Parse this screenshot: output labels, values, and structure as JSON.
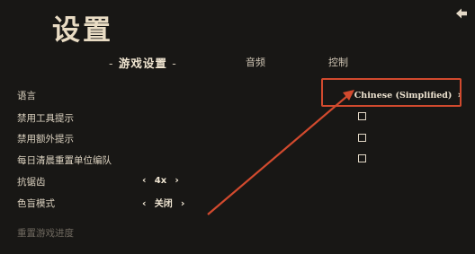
{
  "page": {
    "title": "设置"
  },
  "tabs": [
    {
      "label": "游戏设置",
      "active": true
    },
    {
      "label": "音频",
      "active": false
    },
    {
      "label": "控制",
      "active": false
    }
  ],
  "tab_dash": "-",
  "settings": {
    "language": {
      "label": "语言",
      "value": "Chinese (Simplified)"
    },
    "disable_tool_tips": {
      "label": "禁用工具提示",
      "checked": false
    },
    "disable_extra_tips": {
      "label": "禁用额外提示",
      "checked": false
    },
    "daily_clear_reset": {
      "label": "每日清晨重置单位编队",
      "checked": false
    },
    "antialiasing": {
      "label": "抗锯齿",
      "value": "4x"
    },
    "colorblind": {
      "label": "色盲模式",
      "value": "关闭"
    }
  },
  "arrows": {
    "left": "‹",
    "right": "›"
  },
  "reset_progress_label": "重置游戏进度",
  "colors": {
    "background": "#181715",
    "text": "#e6dccb",
    "annotation": "#d24a2e",
    "disabled_text": "#6f695f"
  },
  "icons": {
    "back": "back-arrow-icon"
  }
}
